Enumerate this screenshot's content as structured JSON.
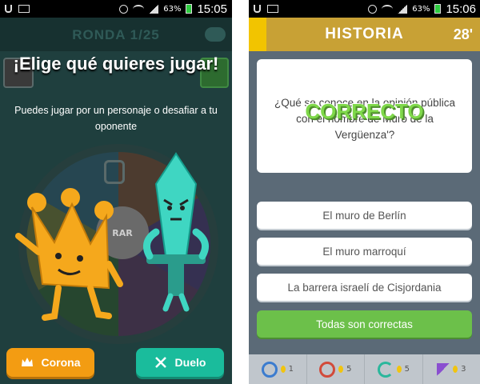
{
  "left": {
    "status": {
      "battery_pct": "63%",
      "time": "15:05"
    },
    "round_title": "RONDA 1/25",
    "heading": "¡Elige qué quieres jugar!",
    "subtitle": "Puedes jugar por un personaje o desafiar a tu oponente",
    "wheel_center_label": "RAR",
    "buttons": {
      "corona": "Corona",
      "duelo": "Duelo"
    }
  },
  "right": {
    "status": {
      "battery_pct": "63%",
      "time": "15:06"
    },
    "topic": "HISTORIA",
    "timer": "28'",
    "question": "¿Qué se conoce en la opinión pública con el nombre de Muro de la Vergüenza'?",
    "feedback": "CORRECTO",
    "answers": [
      {
        "label": "El muro de Berlín"
      },
      {
        "label": "El muro marroquí"
      },
      {
        "label": "La barrera israelí de Cisjordania"
      },
      {
        "label": "Todas son correctas"
      }
    ],
    "powerups": [
      {
        "icon": "clock-icon",
        "count": "1"
      },
      {
        "icon": "bomb-icon",
        "count": "5"
      },
      {
        "icon": "refresh-icon",
        "count": "5"
      },
      {
        "icon": "skip-icon",
        "count": "3"
      }
    ]
  },
  "colors": {
    "corona": "#f39c12",
    "duelo": "#1abc9c",
    "topic": "#c8a135",
    "correct": "#6cc04a"
  }
}
